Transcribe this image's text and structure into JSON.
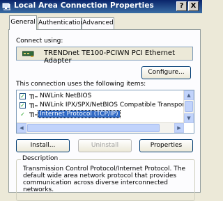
{
  "window": {
    "title": "Local Area Connection Properties",
    "help_label": "?",
    "close_label": "X"
  },
  "tabs": [
    {
      "label": "General",
      "active": true
    },
    {
      "label": "Authentication",
      "active": false
    },
    {
      "label": "Advanced",
      "active": false
    }
  ],
  "general": {
    "connect_using_label": "Connect using:",
    "adapter_name": "TRENDnet TE100-PCIWN PCI Ethernet Adapter",
    "configure_label": "Configure...",
    "items_label": "This connection uses the following items:",
    "items": [
      {
        "label": "NWLink NetBIOS",
        "checked": true,
        "selected": false
      },
      {
        "label": "NWLink IPX/SPX/NetBIOS Compatible Transport Proto",
        "checked": true,
        "selected": false
      },
      {
        "label": "Internet Protocol (TCP/IP)",
        "checked": true,
        "selected": true
      }
    ],
    "buttons": {
      "install": "Install...",
      "uninstall": "Uninstall",
      "properties": "Properties"
    },
    "description_title": "Description",
    "description_text": "Transmission Control Protocol/Internet Protocol. The default wide area network protocol that provides communication across diverse interconnected networks."
  },
  "colors": {
    "titlebar_start": "#0a246a",
    "titlebar_end": "#3a6ea5",
    "selection": "#316ac5",
    "dialog_bg": "#ece9d8"
  }
}
